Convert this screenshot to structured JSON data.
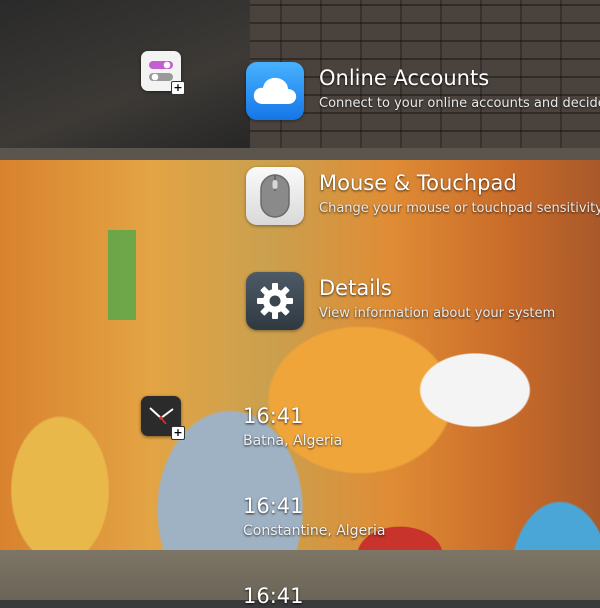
{
  "settings_results": [
    {
      "name": "online-accounts",
      "title": "Online Accounts",
      "description": "Connect to your online accounts and decide",
      "icon": "cloud-icon"
    },
    {
      "name": "mouse-touchpad",
      "title": "Mouse & Touchpad",
      "description": "Change your mouse or touchpad sensitivity a",
      "icon": "mouse-icon"
    },
    {
      "name": "details",
      "title": "Details",
      "description": "View information about your system",
      "icon": "gear-icon"
    }
  ],
  "world_clocks": [
    {
      "time": "16:41",
      "place": "Batna, Algeria"
    },
    {
      "time": "16:41",
      "place": "Constantine, Algeria"
    },
    {
      "time": "16:41",
      "place": ""
    }
  ],
  "favorites": [
    {
      "name": "tweaks",
      "icon": "toggle-switches-icon"
    },
    {
      "name": "clocks",
      "icon": "clock-icon"
    }
  ],
  "add_badge_symbol": "+",
  "colors": {
    "text": "#ffffff",
    "online_accounts_blue": "#1e88f0",
    "details_dark": "#3a4550"
  }
}
